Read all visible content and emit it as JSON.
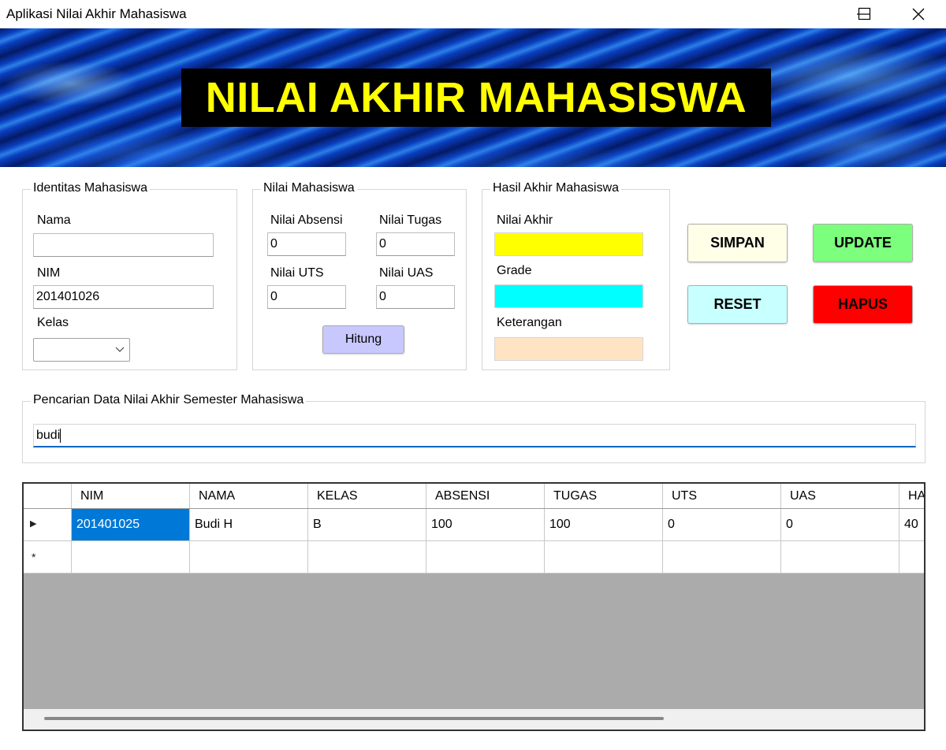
{
  "window": {
    "title": "Aplikasi Nilai Akhir Mahasiswa"
  },
  "banner": {
    "title": "NILAI AKHIR MAHASISWA"
  },
  "identitas": {
    "legend": "Identitas Mahasiswa",
    "nama_label": "Nama",
    "nama_value": "",
    "nim_label": "NIM",
    "nim_value": "201401026",
    "kelas_label": "Kelas",
    "kelas_value": ""
  },
  "nilai": {
    "legend": "Nilai Mahasiswa",
    "absensi_label": "Nilai Absensi",
    "absensi_value": "0",
    "tugas_label": "Nilai Tugas",
    "tugas_value": "0",
    "uts_label": "Nilai UTS",
    "uts_value": "0",
    "uas_label": "Nilai UAS",
    "uas_value": "0",
    "hitung_label": "Hitung"
  },
  "hasil": {
    "legend": "Hasil Akhir Mahasiswa",
    "nilai_akhir_label": "Nilai Akhir",
    "grade_label": "Grade",
    "keterangan_label": "Keterangan",
    "colors": {
      "nilai_akhir": "#ffff00",
      "grade": "#00ffff",
      "keterangan": "#ffe4c4"
    }
  },
  "actions": {
    "simpan": "SIMPAN",
    "update": "UPDATE",
    "reset": "RESET",
    "hapus": "HAPUS",
    "colors": {
      "simpan": "#ffffe8",
      "update": "#7cff7c",
      "reset": "#c8ffff",
      "hapus": "#ff0000"
    }
  },
  "search": {
    "legend": "Pencarian Data Nilai Akhir Semester Mahasiswa",
    "value": "budi"
  },
  "table": {
    "columns": [
      "NIM",
      "NAMA",
      "KELAS",
      "ABSENSI",
      "TUGAS",
      "UTS",
      "UAS",
      "HA"
    ],
    "rows": [
      [
        "201401025",
        "Budi H",
        "B",
        "100",
        "100",
        "0",
        "0",
        "40"
      ]
    ],
    "new_row_marker": "*",
    "current_row_marker": "▶"
  }
}
